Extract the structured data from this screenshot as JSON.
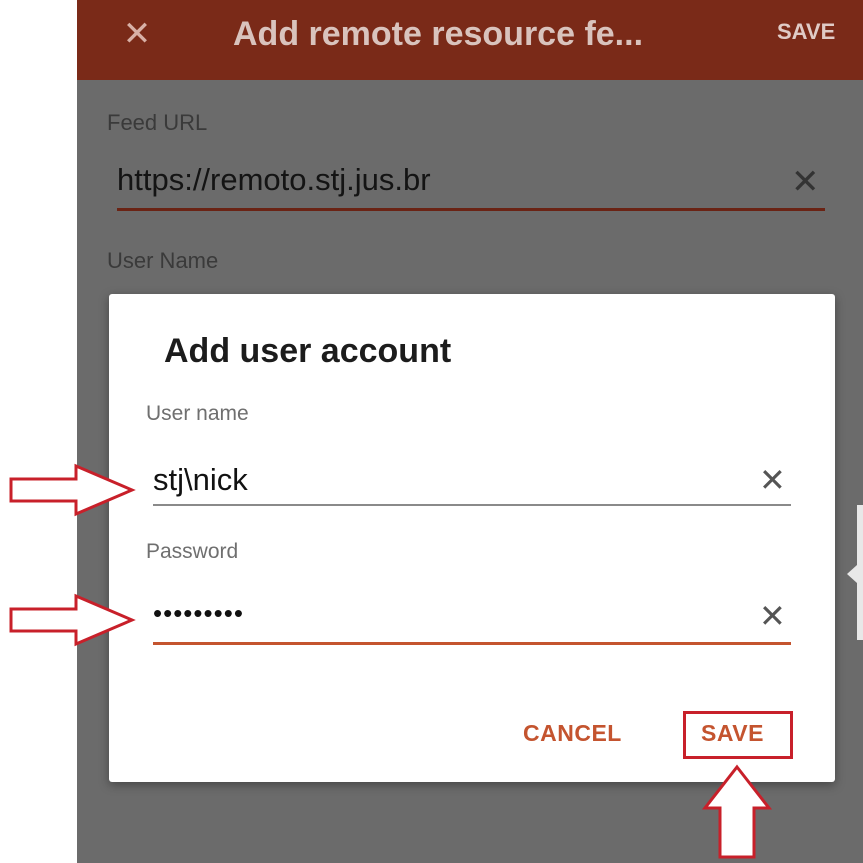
{
  "appbar": {
    "close_icon": "close-icon",
    "title": "Add remote resource fe...",
    "save_label": "SAVE"
  },
  "form": {
    "feed_url_label": "Feed URL",
    "feed_url_value": "https://remoto.stj.jus.br",
    "user_name_label": "User Name"
  },
  "dialog": {
    "title": "Add user account",
    "user_name_label": "User name",
    "user_name_value": "stj\\nick",
    "password_label": "Password",
    "password_value": "•••••••••",
    "cancel_label": "CANCEL",
    "save_label": "SAVE"
  },
  "colors": {
    "appbar": "#7a2a18",
    "accent": "#c4542f",
    "annotation": "#c8202a"
  }
}
